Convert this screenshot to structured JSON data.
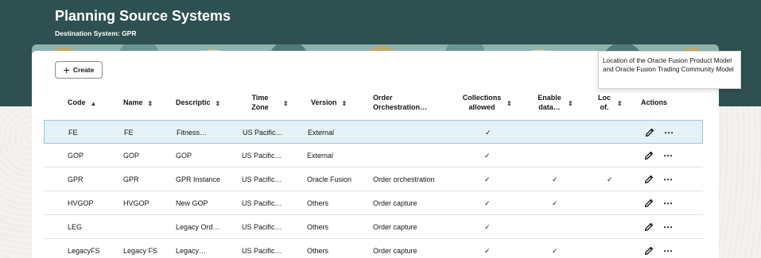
{
  "page": {
    "title": "Planning Source Systems",
    "subtitle": "Destination System: GPR"
  },
  "toolbar": {
    "create_label": "Create"
  },
  "tooltip": {
    "text": "Location of the Oracle Fusion Product Model and Oracle Fusion Trading Community Model"
  },
  "columns": [
    {
      "label": "Code",
      "sort": "ascending"
    },
    {
      "label": "Name",
      "sort": "sortable"
    },
    {
      "label": "Descriptic",
      "sort": "sortable"
    },
    {
      "label": "Time Zone",
      "sort": "sortable"
    },
    {
      "label": "Version",
      "sort": "sortable"
    },
    {
      "label": "Order Orchestration…",
      "sort": "sortable"
    },
    {
      "label": "Collections allowed",
      "sort": "sortable"
    },
    {
      "label": "Enable data…",
      "sort": "sortable"
    },
    {
      "label": "Loc of.",
      "sort": "sortable"
    },
    {
      "label": "Actions",
      "sort": "none"
    }
  ],
  "rows": [
    {
      "code": "FE",
      "name": "FE",
      "description": "Fitness…",
      "timezone": "US Pacific…",
      "version": "External",
      "order": "",
      "collections": "✓",
      "enable": "",
      "loc": "",
      "selected": true
    },
    {
      "code": "GOP",
      "name": "GOP",
      "description": "GOP",
      "timezone": "US Pacific…",
      "version": "External",
      "order": "",
      "collections": "✓",
      "enable": "",
      "loc": "",
      "selected": false
    },
    {
      "code": "GPR",
      "name": "GPR",
      "description": "GPR Instance",
      "timezone": "US Pacific…",
      "version": "Oracle Fusion",
      "order": "Order orchestration",
      "collections": "✓",
      "enable": "✓",
      "loc": "✓",
      "selected": false
    },
    {
      "code": "HVGOP",
      "name": "HVGOP",
      "description": "New GOP",
      "timezone": "US Pacific…",
      "version": "Others",
      "order": "Order capture",
      "collections": "✓",
      "enable": "✓",
      "loc": "",
      "selected": false
    },
    {
      "code": "LEG",
      "name": "",
      "description": "Legacy Ord…",
      "timezone": "US Pacific…",
      "version": "Others",
      "order": "Order capture",
      "collections": "✓",
      "enable": "",
      "loc": "",
      "selected": false
    },
    {
      "code": "LegacyFS",
      "name": "Legacy FS",
      "description": "Legacy…",
      "timezone": "US Pacific…",
      "version": "Others",
      "order": "Order capture",
      "collections": "✓",
      "enable": "✓",
      "loc": "",
      "selected": false
    }
  ],
  "actions": {
    "edit_icon": "pencil-icon",
    "more_label": "⋯"
  },
  "colors": {
    "header": "#2f5050",
    "selected_row": "#e4f1f7",
    "accent": "#8fb2ad"
  }
}
